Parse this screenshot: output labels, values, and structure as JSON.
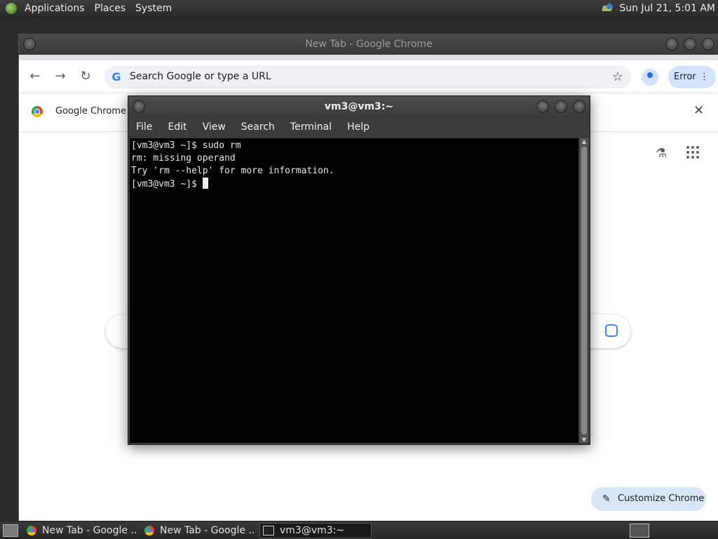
{
  "top_panel": {
    "menus": [
      "Applications",
      "Places",
      "System"
    ],
    "clock": "Sun Jul 21,  5:01 AM"
  },
  "chrome": {
    "window_title": "New Tab - Google Chrome",
    "omnibox_placeholder": "Search Google or type a URL",
    "profile_label": "Error",
    "infobar_text": "Google Chrome isn't",
    "customize_label": "Customize Chrome"
  },
  "terminal": {
    "title": "vm3@vm3:~",
    "menu": [
      "File",
      "Edit",
      "View",
      "Search",
      "Terminal",
      "Help"
    ],
    "lines": [
      "[vm3@vm3 ~]$ sudo rm",
      "rm: missing operand",
      "Try 'rm --help' for more information.",
      "[vm3@vm3 ~]$ "
    ]
  },
  "taskbar": {
    "tasks": [
      "New Tab - Google ...",
      "New Tab - Google ...",
      "vm3@vm3:~"
    ]
  }
}
